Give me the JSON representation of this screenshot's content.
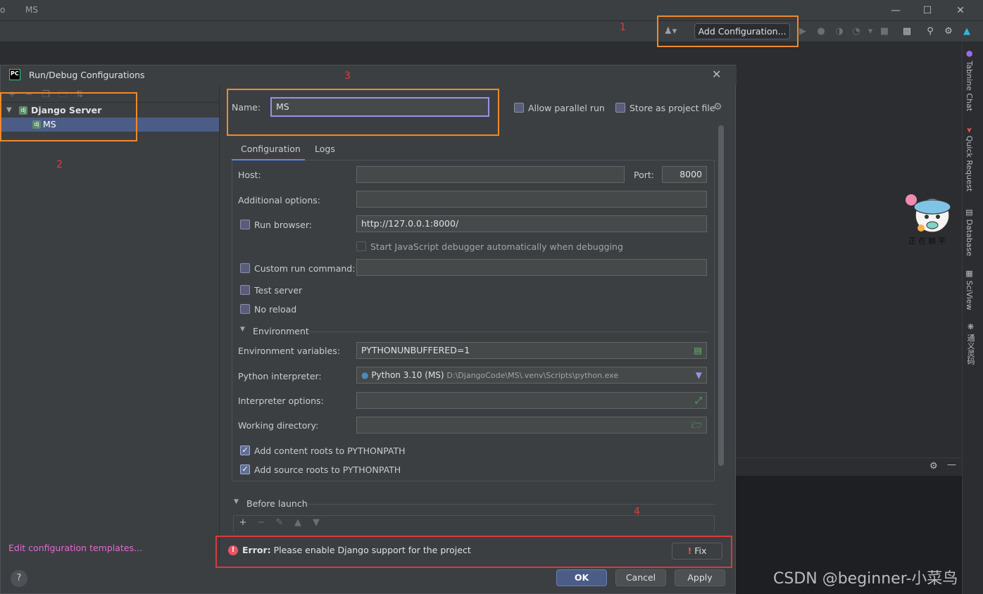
{
  "window": {
    "title_fragment": "o",
    "project": "MS",
    "controls": [
      "—",
      "☐",
      "✕"
    ]
  },
  "toolbar": {
    "add_configuration": "Add Configuration..."
  },
  "dialog": {
    "title": "Run/Debug Configurations",
    "logo_text": "PC",
    "tree": {
      "group_label": "Django Server",
      "item_label": "MS"
    },
    "edit_templates": "Edit configuration templates...",
    "help": "?",
    "name_label": "Name:",
    "name_value": "MS",
    "allow_parallel": "Allow parallel run",
    "store_project": "Store as project file",
    "tabs": [
      "Configuration",
      "Logs"
    ],
    "host_label": "Host:",
    "host_value": "",
    "port_label": "Port:",
    "port_value": "8000",
    "additional_label": "Additional options:",
    "additional_value": "",
    "run_browser_label": "Run browser:",
    "run_browser_value": "http://127.0.0.1:8000/",
    "js_debugger_label": "Start JavaScript debugger automatically when debugging",
    "custom_run_label": "Custom run command:",
    "test_server_label": "Test server",
    "no_reload_label": "No reload",
    "environment_header": "Environment",
    "env_vars_label": "Environment variables:",
    "env_vars_value": "PYTHONUNBUFFERED=1",
    "interpreter_label": "Python interpreter:",
    "interpreter_name": "Python 3.10 (MS)",
    "interpreter_path": "D:\\DjangoCode\\MS\\.venv\\Scripts\\python.exe",
    "interp_options_label": "Interpreter options:",
    "workdir_label": "Working directory:",
    "content_roots_label": "Add content roots to PYTHONPATH",
    "source_roots_label": "Add source roots to PYTHONPATH",
    "before_launch": "Before launch",
    "error_prefix": "Error:",
    "error_message": "Please enable Django support for the project",
    "fix": "Fix",
    "ok": "OK",
    "cancel": "Cancel",
    "apply": "Apply"
  },
  "right_strip": [
    "Tabnine Chat",
    "Quick Request",
    "Database",
    "SciView",
    "通义灵码"
  ],
  "sticker_text": "正在躺平",
  "annotations": [
    "1",
    "2",
    "3",
    "4"
  ],
  "watermark": "CSDN @beginner-小菜鸟",
  "colors": {
    "accent": "#548af7",
    "annotation_box": "#f0892b",
    "annotation_num": "#e23b3b",
    "error": "#e55765",
    "link": "#e36ad2"
  }
}
